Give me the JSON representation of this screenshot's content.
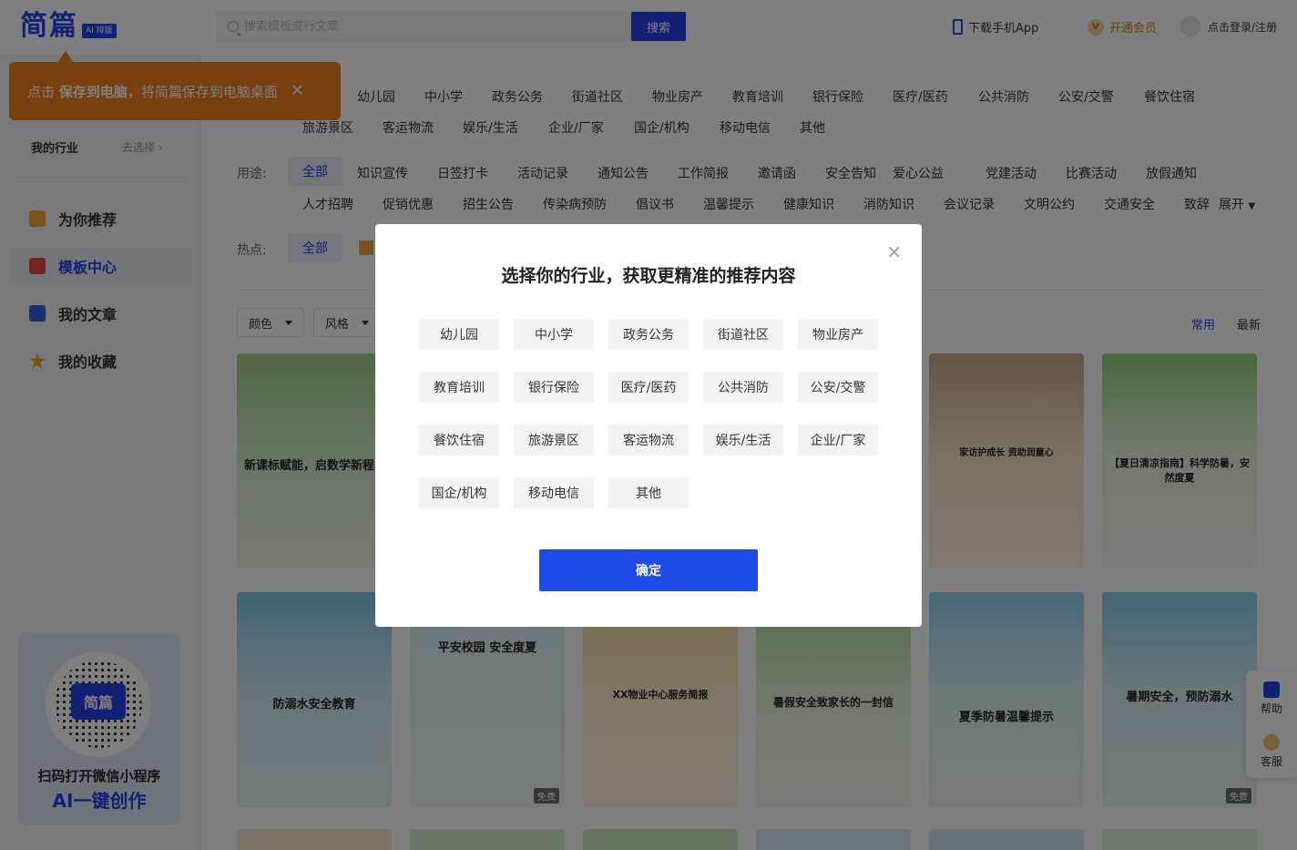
{
  "header": {
    "logo": "简篇",
    "logo_badge": "AI 排版",
    "search_placeholder": "搜索模板或行文章",
    "search_button": "搜索",
    "download_app": "下载手机App",
    "vip_icon_text": "V",
    "vip": "开通会员",
    "login": "点击登录/注册"
  },
  "tooltip": {
    "prefix": "点击",
    "highlight": "保存到电脑",
    "suffix": "，将简篇保存到电脑桌面",
    "close": "✕"
  },
  "sidebar": {
    "my_industry": "我的行业",
    "go_choose": "去选择 ›",
    "items": [
      {
        "label": "为你推荐"
      },
      {
        "label": "模板中心"
      },
      {
        "label": "我的文章"
      },
      {
        "label": "我的收藏"
      }
    ],
    "qr_center": "简篇",
    "qr_line1": "扫码打开微信小程序",
    "qr_line2": "AI一键创作"
  },
  "filters": {
    "industry_row1": [
      "幼儿园",
      "中小学",
      "政务公务",
      "街道社区",
      "物业房产",
      "教育培训",
      "银行保险",
      "医疗/医药",
      "公共消防",
      "公安/交警",
      "餐饮住宿"
    ],
    "industry_row2": [
      "旅游景区",
      "客运物流",
      "娱乐/生活",
      "企业/厂家",
      "国企/机构",
      "移动电信",
      "其他"
    ],
    "use_label": "用途:",
    "use_all": "全部",
    "use_row1": [
      "知识宣传",
      "日签打卡",
      "活动记录",
      "通知公告",
      "工作简报",
      "邀请函",
      "安全告知",
      "爱心公益",
      "党建活动",
      "比赛活动",
      "放假通知"
    ],
    "use_row2": [
      "人才招聘",
      "促销优惠",
      "招生公告",
      "传染病预防",
      "倡议书",
      "温馨提示",
      "健康知识",
      "消防知识",
      "会议记录",
      "文明公约",
      "交通安全",
      "致辞"
    ],
    "expand": "展开",
    "hot_label": "热点:",
    "hot_all": "全部",
    "color": "颜色",
    "style": "风格",
    "sort_common": "常用",
    "sort_latest": "最新"
  },
  "cards": [
    {
      "title": "新课标赋能，启数学新程"
    },
    {
      "title": "家访护成长 资助润童心"
    },
    {
      "title": "【夏日清凉指南】科学防暑，安然度夏"
    },
    {
      "title": "防溺水安全教育"
    },
    {
      "title": "平安校园 安全度夏"
    },
    {
      "title": "XX物业中心服务简报"
    },
    {
      "title": "暑假安全致家长的一封信"
    },
    {
      "title": "夏季防暑温馨提示"
    },
    {
      "title": "暑期安全，预防溺水"
    }
  ],
  "free_badge": "免费",
  "float_tools": {
    "help": "帮助",
    "service": "客服"
  },
  "modal": {
    "title": "选择你的行业，获取更精准的推荐内容",
    "close": "×",
    "options": [
      "幼儿园",
      "中小学",
      "政务公务",
      "街道社区",
      "物业房产",
      "教育培训",
      "银行保险",
      "医疗/医药",
      "公共消防",
      "公安/交警",
      "餐饮住宿",
      "旅游景区",
      "客运物流",
      "娱乐/生活",
      "企业/厂家",
      "国企/机构",
      "移动电信",
      "其他"
    ],
    "confirm": "确定"
  },
  "colors": {
    "brand": "#2440e6",
    "tooltip": "#ef7d1c",
    "confirm": "#1f4be8"
  }
}
